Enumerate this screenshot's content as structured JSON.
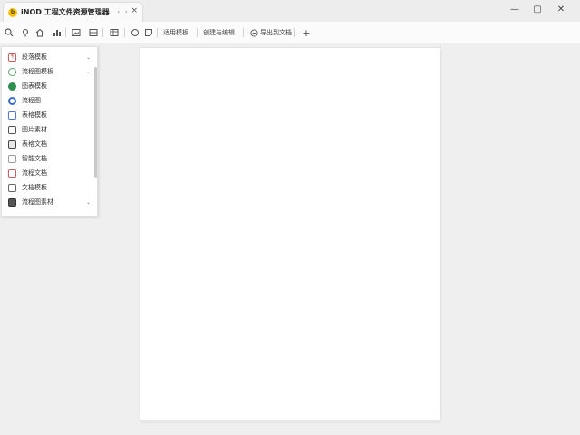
{
  "titlebar": {
    "app_logo_text": "b",
    "tab_title": "iNOD 工程文件资源管理器",
    "tab_nav": "‹ ›",
    "tab_close": "×",
    "window_controls": {
      "minimize": "—",
      "maximize": "▢",
      "close": "✕"
    }
  },
  "toolbar": {
    "buttons": [
      {
        "label": "适用模板"
      },
      {
        "label": "创建与编辑"
      },
      {
        "label": "导出到文档"
      }
    ],
    "add_label": "+"
  },
  "panel": {
    "items": [
      {
        "label": "段落模板",
        "icon": "paragraph-icon",
        "color": "#d45b5b",
        "chevron": "⌄"
      },
      {
        "label": "流程图模板",
        "icon": "flowchart-icon",
        "color": "#5aa469",
        "chevron": "⌄"
      },
      {
        "label": "图表模板",
        "icon": "chart-icon",
        "color": "#2d8f4e",
        "chevron": ""
      },
      {
        "label": "流程图",
        "icon": "process-icon",
        "color": "#3a6fc4",
        "chevron": ""
      },
      {
        "label": "表格模板",
        "icon": "table-icon",
        "color": "#4a7ec9",
        "chevron": ""
      },
      {
        "label": "图片素材",
        "icon": "image-icon",
        "color": "#555555",
        "chevron": ""
      },
      {
        "label": "表格文档",
        "icon": "sheet-icon",
        "color": "#444444",
        "chevron": ""
      },
      {
        "label": "智能文档",
        "icon": "smart-doc-icon",
        "color": "#777777",
        "chevron": ""
      },
      {
        "label": "流程文档",
        "icon": "process-doc-icon",
        "color": "#d45b5b",
        "chevron": ""
      },
      {
        "label": "文档模板",
        "icon": "doc-template-icon",
        "color": "#555555",
        "chevron": ""
      },
      {
        "label": "流程图素材",
        "icon": "material-icon",
        "color": "#333333",
        "chevron": "⌄"
      }
    ]
  }
}
